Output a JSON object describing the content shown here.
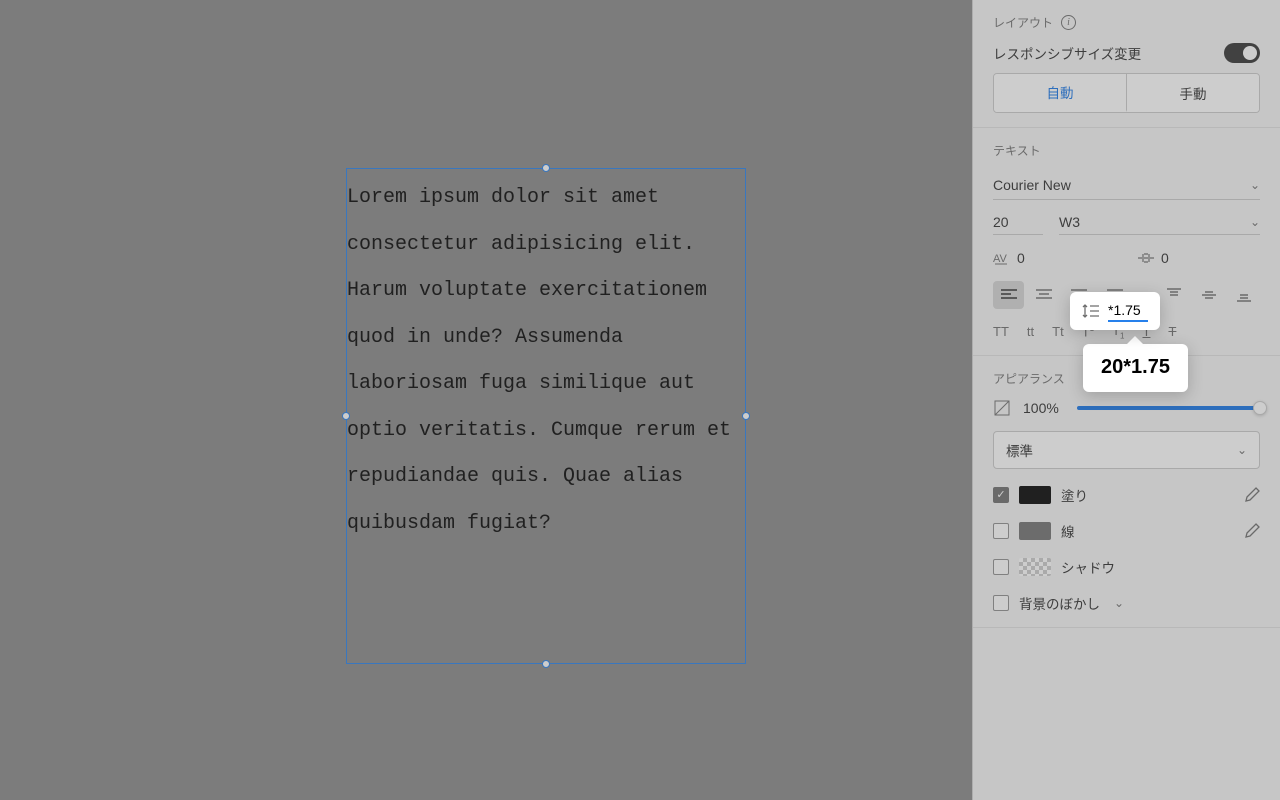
{
  "canvas": {
    "text": "Lorem ipsum dolor sit amet consectetur adipisicing elit. Harum voluptate exercitationem quod in unde? Assumenda laboriosam fuga similique aut optio veritatis. Cumque rerum et repudiandae quis. Quae alias quibusdam fugiat?"
  },
  "panel": {
    "layout": {
      "title": "レイアウト",
      "responsive_label": "レスポンシブサイズ変更",
      "auto": "自動",
      "manual": "手動"
    },
    "text": {
      "title": "テキスト",
      "font": "Courier New",
      "size": "20",
      "weight": "W3",
      "letter_spacing": "0",
      "line_height_input": "*1.75",
      "line_height_tooltip": "20*1.75",
      "paragraph_spacing": "0"
    },
    "appearance": {
      "title": "アピアランス",
      "opacity": "100%",
      "blend": "標準",
      "fill": "塗り",
      "stroke": "線",
      "shadow": "シャドウ",
      "blur": "背景のぼかし"
    }
  }
}
